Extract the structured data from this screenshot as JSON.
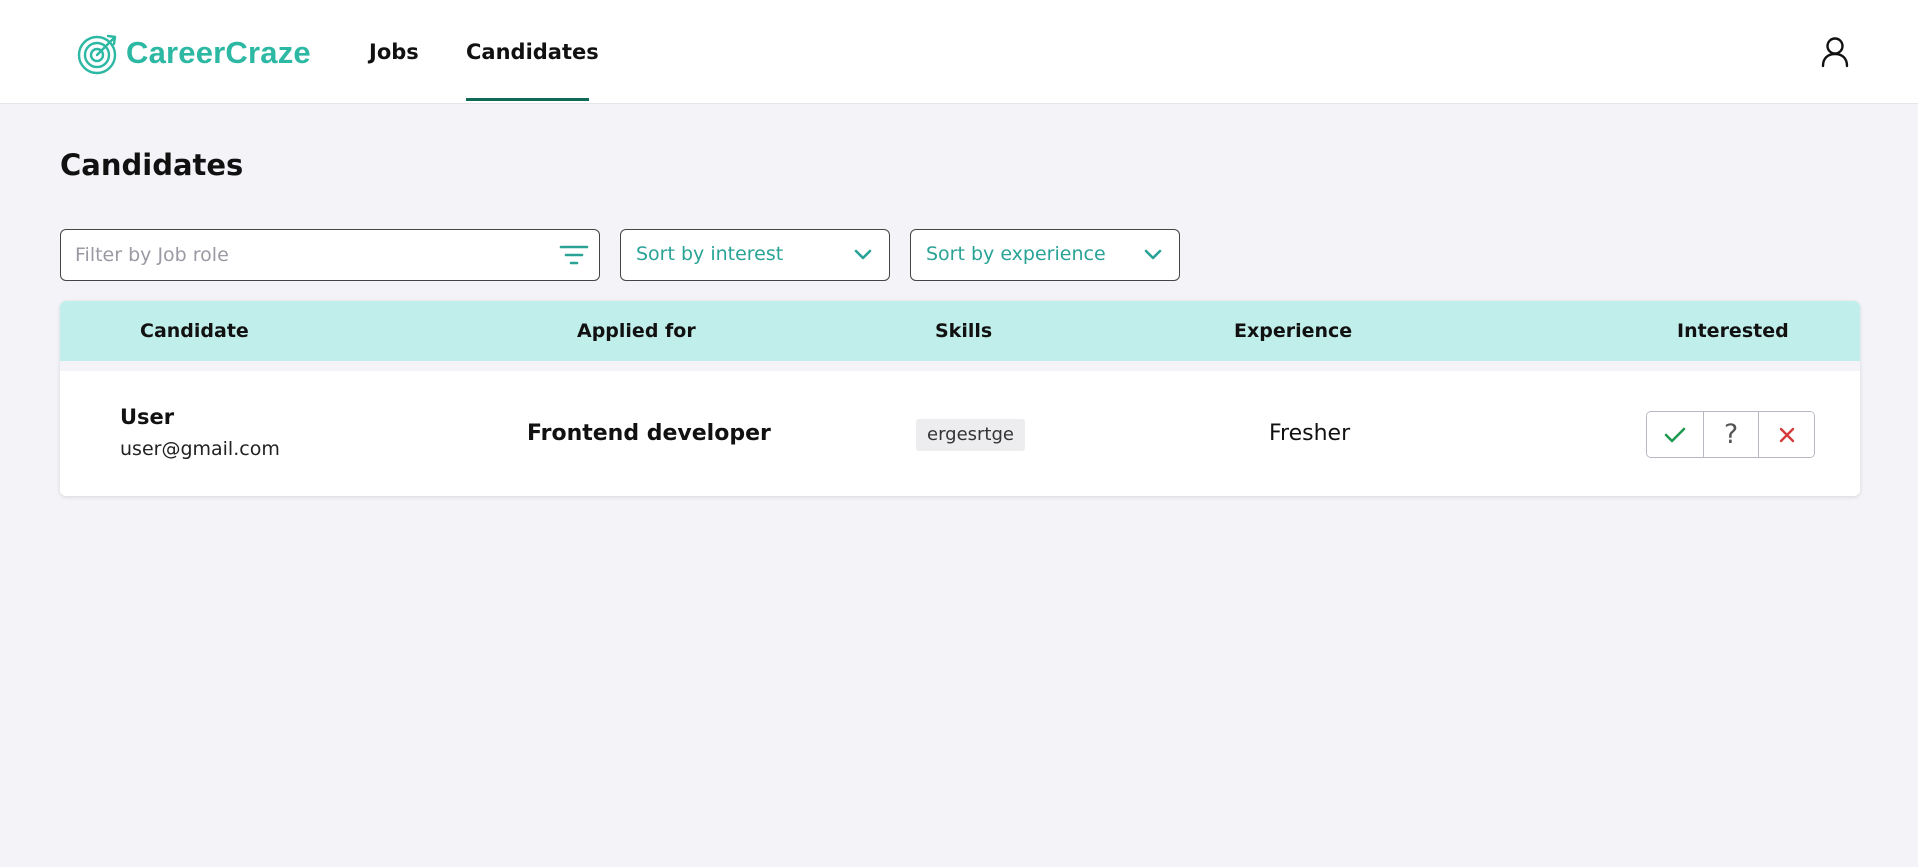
{
  "app": {
    "brand": "CareerCraze",
    "brand_color": "#2cb8a3"
  },
  "nav": {
    "items": [
      {
        "label": "Jobs",
        "active": false
      },
      {
        "label": "Candidates",
        "active": true
      }
    ],
    "active_color": "#0d6b56"
  },
  "page": {
    "title": "Candidates"
  },
  "filters": {
    "job_role_placeholder": "Filter by Job role",
    "job_role_value": "",
    "sort_interest": "Sort by interest",
    "sort_experience": "Sort by experience",
    "accent": "#2aa396"
  },
  "table": {
    "headers": [
      "Candidate",
      "Applied for",
      "Skills",
      "Experience",
      "Interested"
    ],
    "header_bg": "#c0eeea",
    "rows": [
      {
        "name": "User",
        "email": "user@gmail.com",
        "applied_for": "Frontend developer",
        "skills": [
          "ergesrtge"
        ],
        "experience": "Fresher",
        "actions": {
          "accept_icon": "check-icon",
          "maybe_label": "?",
          "reject_icon": "close-icon"
        }
      }
    ]
  },
  "icons": {
    "filter": "filter-icon",
    "chevron": "chevron-down-icon",
    "user": "user-icon",
    "logo": "target-icon"
  }
}
